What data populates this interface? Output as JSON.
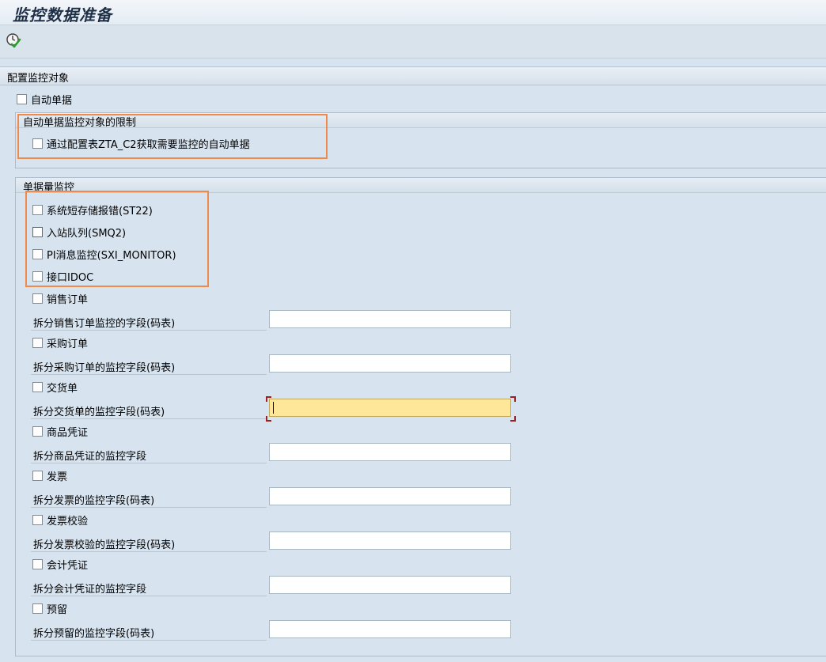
{
  "window": {
    "title": "监控数据准备"
  },
  "toolbar": {
    "execute_icon": "execute-clock-check-icon"
  },
  "config_section": {
    "title": "配置监控对象",
    "auto_doc": {
      "label": "自动单据",
      "checked": false
    }
  },
  "auto_doc_restriction": {
    "title": "自动单据监控对象的限制",
    "option": {
      "label": "通过配置表ZTA_C2获取需要监控的自动单据",
      "checked": false
    }
  },
  "volume_monitor": {
    "title": "单据量监控",
    "items": [
      {
        "label": "系统短存储报错(ST22)",
        "checked": false
      },
      {
        "label": "入站队列(SMQ2)",
        "checked": false
      },
      {
        "label": "PI消息监控(SXI_MONITOR)",
        "checked": false
      },
      {
        "label": "接口IDOC",
        "checked": false
      }
    ],
    "documents": [
      {
        "label": "销售订单",
        "checked": false,
        "field_label": "拆分销售订单监控的字段(码表)",
        "field_value": ""
      },
      {
        "label": "采购订单",
        "checked": false,
        "field_label": "拆分采购订单的监控字段(码表)",
        "field_value": ""
      },
      {
        "label": "交货单",
        "checked": false,
        "field_label": "拆分交货单的监控字段(码表)",
        "field_value": ""
      },
      {
        "label": "商品凭证",
        "checked": false,
        "field_label": "拆分商品凭证的监控字段",
        "field_value": ""
      },
      {
        "label": "发票",
        "checked": false,
        "field_label": "拆分发票的监控字段(码表)",
        "field_value": ""
      },
      {
        "label": "发票校验",
        "checked": false,
        "field_label": "拆分发票校验的监控字段(码表)",
        "field_value": ""
      },
      {
        "label": "会计凭证",
        "checked": false,
        "field_label": "拆分会计凭证的监控字段",
        "field_value": ""
      },
      {
        "label": "预留",
        "checked": false,
        "field_label": "拆分预留的监控字段(码表)",
        "field_value": ""
      }
    ]
  },
  "colors": {
    "background": "#d7e4f0",
    "highlight": "#f08a4b",
    "focused_input": "#ffe79a"
  }
}
